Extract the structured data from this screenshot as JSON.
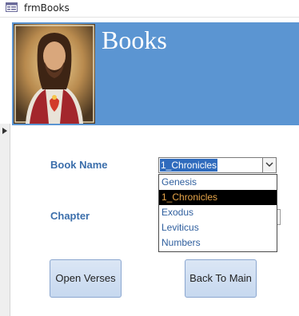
{
  "window": {
    "title": "frmBooks",
    "icon": "form-icon"
  },
  "header": {
    "title": "Books",
    "image": "jesus-portrait"
  },
  "form": {
    "book_name_label": "Book Name",
    "chapter_label": "Chapter",
    "book_combo": {
      "value": "1_Chronicles",
      "options": [
        "Genesis",
        "1_Chronicles",
        "Exodus",
        "Leviticus",
        "Numbers"
      ],
      "selected_index": 1
    }
  },
  "buttons": {
    "open_verses": "Open Verses",
    "back_to_main": "Back To Main"
  },
  "colors": {
    "header_bg": "#5b95d2",
    "label_text": "#3b6eab",
    "selection_bg": "#000000",
    "selection_text": "#e8a64a",
    "button_bg": "#c6d8ef"
  }
}
